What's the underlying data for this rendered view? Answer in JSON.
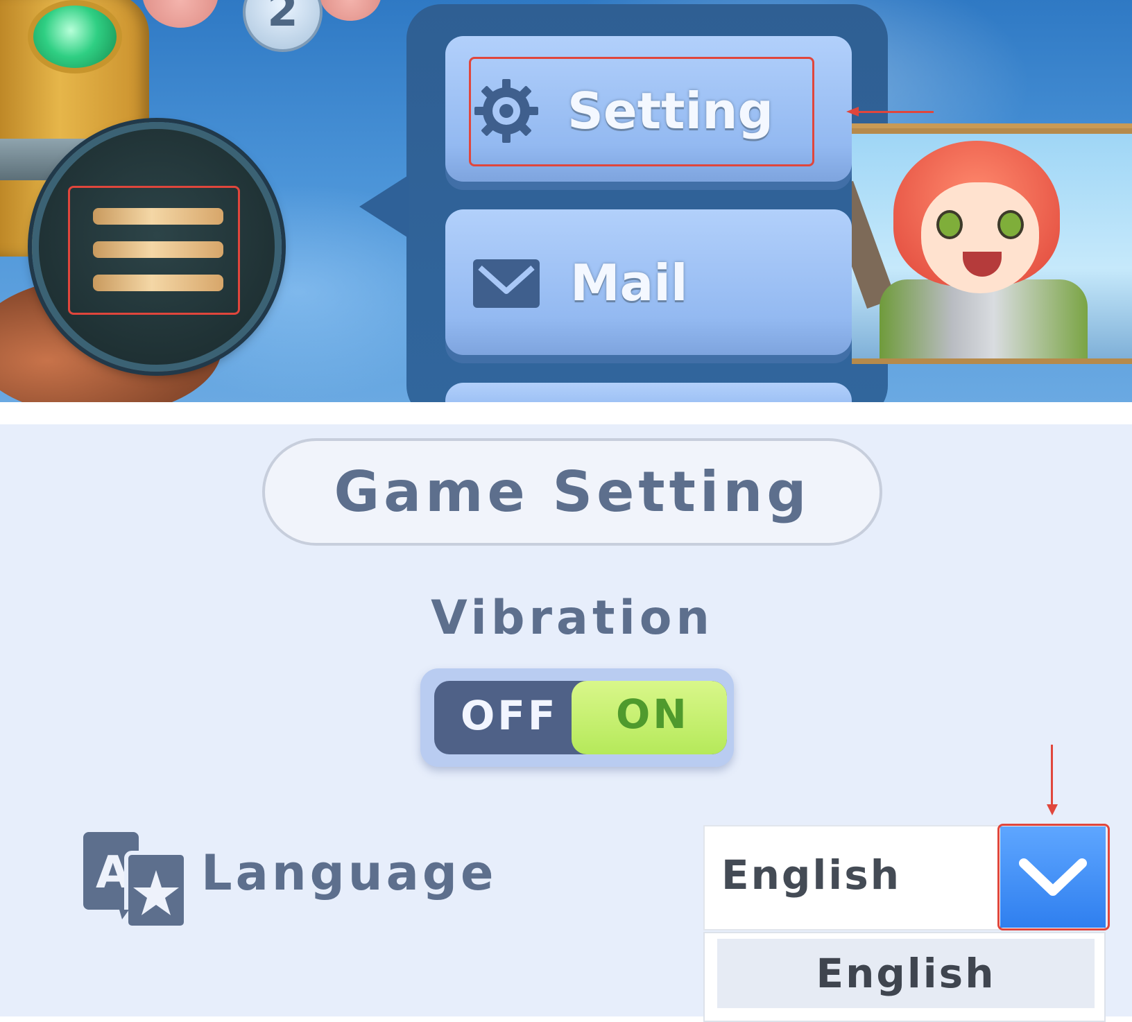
{
  "hud": {
    "level_badge": "2",
    "menu_button_icon": "hamburger-menu-icon"
  },
  "popup_menu": {
    "items": [
      {
        "label": "Setting",
        "icon": "gear-icon"
      },
      {
        "label": "Mail",
        "icon": "envelope-icon"
      }
    ]
  },
  "settings": {
    "title": "Game Setting",
    "vibration": {
      "label": "Vibration",
      "off_label": "OFF",
      "on_label": "ON",
      "state": "ON"
    },
    "language": {
      "label": "Language",
      "icon": "translate-icon",
      "selected": "English",
      "options": [
        "English"
      ]
    }
  },
  "colors": {
    "annotation_red": "#e0463c",
    "dropdown_blue": "#2f7fef",
    "toggle_on_green": "#b5e95a",
    "panel_background": "#e7eefb"
  }
}
